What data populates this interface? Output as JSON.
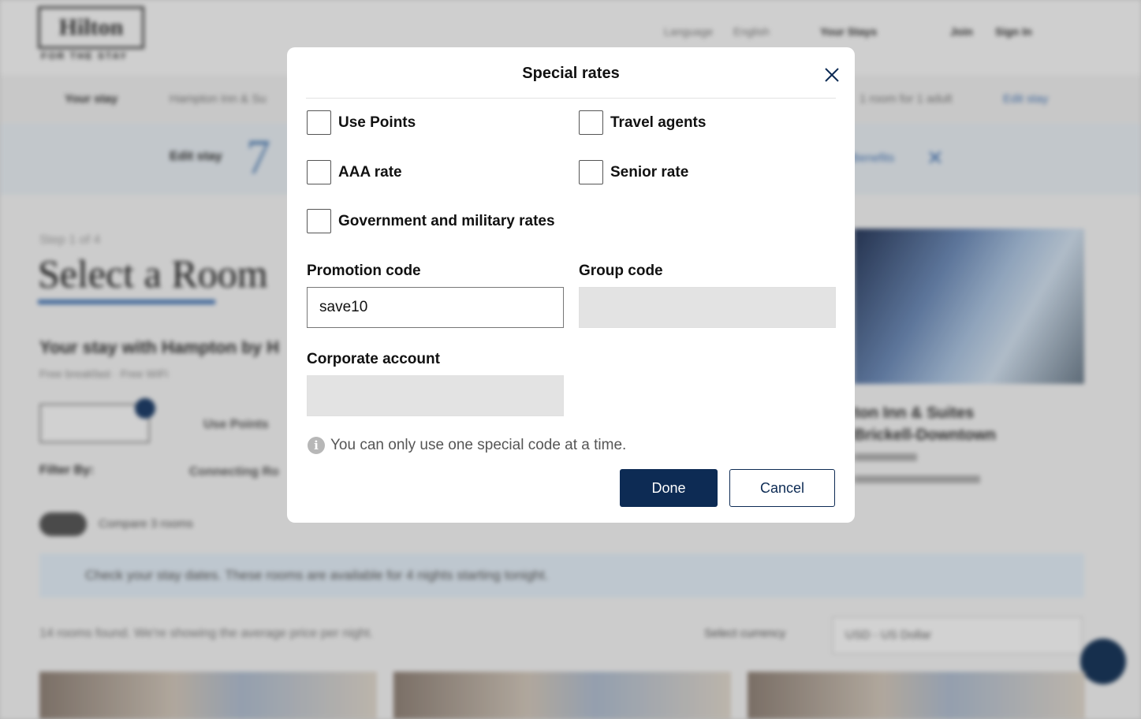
{
  "background": {
    "brand": {
      "name": "Hilton",
      "tagline": "FOR THE STAY"
    },
    "header_nav": {
      "language_label": "Language",
      "language_value": "English",
      "your_stays": "Your Stays",
      "join": "Join",
      "sign_in": "Sign In"
    },
    "stay_bar": {
      "label": "Your stay",
      "search_text": "Hampton Inn & Su",
      "rooms_text": "1 room for 1 adult",
      "edit_link": "Edit stay"
    },
    "edit_row": {
      "label": "Edit stay",
      "day": "7",
      "link": "Benefits"
    },
    "step_text": "Step 1 of 4",
    "page_title": "Select a Room",
    "your_stay_heading": "Your stay with Hampton by H",
    "amenities": "Free breakfast · Free WiFi",
    "filter_label": "Filter By:",
    "filter_option": "Connecting Ro",
    "use_points_option": "Use Points",
    "compare_label": "Compare 3 rooms",
    "notice_text": "Check your stay dates. These rooms are available for 4 nights starting tonight.",
    "rooms_found": "14 rooms found. We're showing the average price per night.",
    "currency_label": "Select currency",
    "currency_value": "USD - US Dollar",
    "hotel": {
      "name_line1": "ton Inn & Suites",
      "name_line2": "Brickell-Downtown"
    }
  },
  "modal": {
    "title": "Special rates",
    "checkboxes": [
      {
        "label": "Use Points",
        "checked": false
      },
      {
        "label": "Travel agents",
        "checked": false
      },
      {
        "label": "AAA rate",
        "checked": false
      },
      {
        "label": "Senior rate",
        "checked": false
      },
      {
        "label": "Government and military rates",
        "checked": false
      }
    ],
    "promotion_code": {
      "label": "Promotion code",
      "value": "save10"
    },
    "group_code": {
      "label": "Group code",
      "value": ""
    },
    "corporate_account": {
      "label": "Corporate account",
      "value": ""
    },
    "info_text": "You can only use one special code at a time.",
    "done_label": "Done",
    "cancel_label": "Cancel"
  },
  "colors": {
    "primary": "#0d2b54",
    "overlay": "#d2d2d2",
    "disabled_input": "#e3e3e3"
  }
}
